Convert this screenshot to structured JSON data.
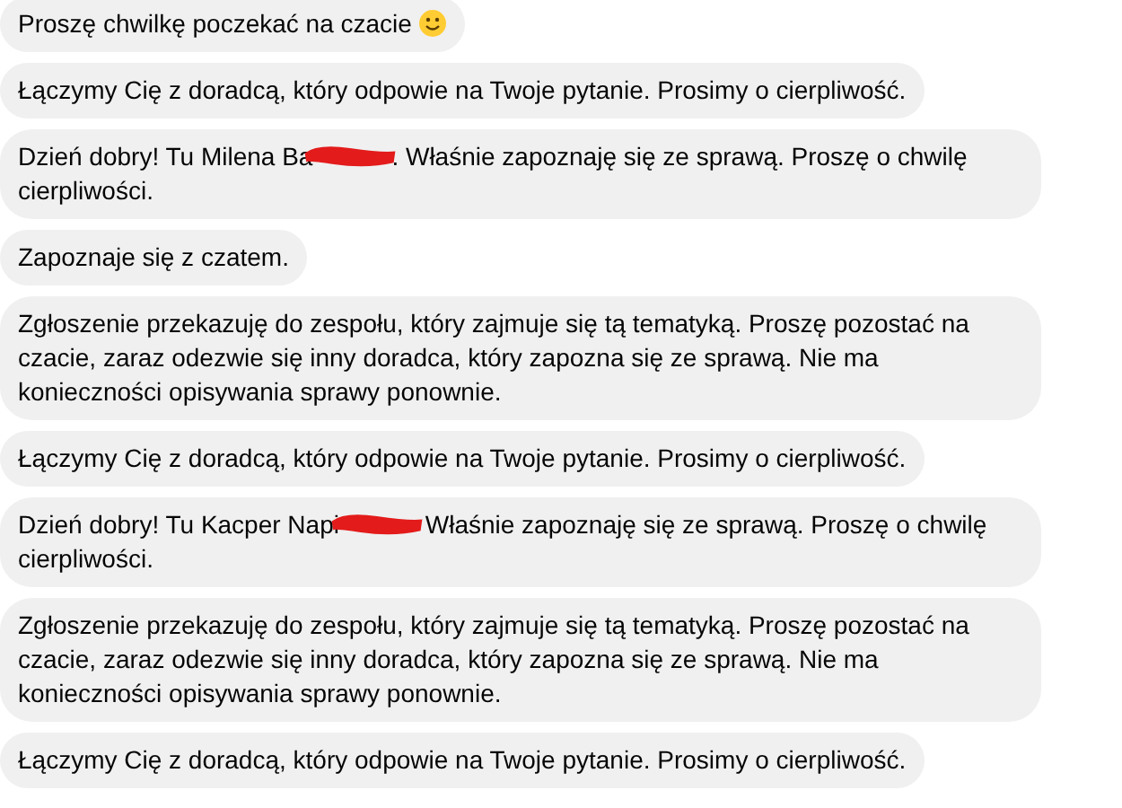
{
  "messages": [
    {
      "parts": [
        {
          "kind": "text",
          "text": "Proszę chwilkę poczekać na czacie "
        },
        {
          "kind": "emoji"
        }
      ]
    },
    {
      "parts": [
        {
          "kind": "text",
          "text": "Łączymy Cię z doradcą, który odpowie na Twoje pytanie. Prosimy o cierpliwość."
        }
      ]
    },
    {
      "parts": [
        {
          "kind": "text",
          "text": "Dzień dobry! Tu Milena Ba"
        },
        {
          "kind": "redaction"
        },
        {
          "kind": "text",
          "text": ". Właśnie zapoznaję się ze sprawą. Proszę o chwilę cierpliwości."
        }
      ]
    },
    {
      "parts": [
        {
          "kind": "text",
          "text": "Zapoznaje się z czatem."
        }
      ]
    },
    {
      "parts": [
        {
          "kind": "text",
          "text": "Zgłoszenie przekazuję do zespołu, który zajmuje się tą tematyką. Proszę pozostać na czacie, zaraz odezwie się inny doradca, który zapozna się ze sprawą. Nie ma konieczności opisywania sprawy ponownie."
        }
      ]
    },
    {
      "parts": [
        {
          "kind": "text",
          "text": "Łączymy Cię z doradcą, który odpowie na Twoje pytanie. Prosimy o cierpliwość."
        }
      ]
    },
    {
      "parts": [
        {
          "kind": "text",
          "text": "Dzień dobry! Tu Kacper Napi"
        },
        {
          "kind": "redaction"
        },
        {
          "kind": "text",
          "text": " Właśnie zapoznaję się ze sprawą. Proszę o chwilę cierpliwości."
        }
      ]
    },
    {
      "parts": [
        {
          "kind": "text",
          "text": "Zgłoszenie przekazuję do zespołu, który zajmuje się tą tematyką. Proszę pozostać na czacie, zaraz odezwie się inny doradca, który zapozna się ze sprawą. Nie ma konieczności opisywania sprawy ponownie."
        }
      ]
    },
    {
      "parts": [
        {
          "kind": "text",
          "text": "Łączymy Cię z doradcą, który odpowie na Twoje pytanie. Prosimy o cierpliwość."
        }
      ]
    }
  ]
}
